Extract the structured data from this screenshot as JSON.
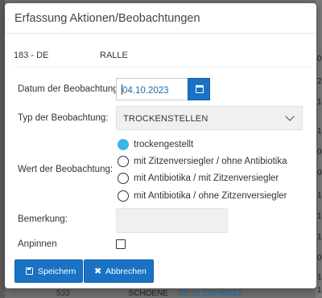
{
  "dialog": {
    "title": "Erfassung Aktionen/Beobachtungen"
  },
  "animal": {
    "id": "183 - DE",
    "name": "RALLE"
  },
  "form": {
    "date_label": "Datum der Beobachtung:",
    "date_value": "04.10.2023",
    "type_label": "Typ der Beobachtung:",
    "type_value": "TROCKENSTELLEN",
    "value_label": "Wert der Beobachtung:",
    "value_options": [
      {
        "label": "trockengestellt",
        "checked": true
      },
      {
        "label": "mit Zitzenversiegler / ohne Antibiotika",
        "checked": false
      },
      {
        "label": "mit Antibiotika / mit Zitzenversiegler",
        "checked": false
      },
      {
        "label": "mit Antibiotika / ohne Zitzenversiegler",
        "checked": false
      }
    ],
    "remark_label": "Bemerkung:",
    "remark_value": "",
    "pin_label": "Anpinnen",
    "pin_checked": false
  },
  "buttons": {
    "save": "Speichern",
    "cancel": "Abbrechen"
  },
  "icons": {
    "date_button": "calendar-icon",
    "select": "chevron-down-icon",
    "save": "floppy-disk-icon",
    "cancel": "close-icon"
  },
  "colors": {
    "primary": "#1a72c4",
    "radio_selected": "#3bb6e4",
    "date_text": "#1a6fb0"
  },
  "background": {
    "row_snippet": [
      "533",
      "SCHOENE",
      "DE 01 200 00533"
    ],
    "right_edge_chars": [
      "0",
      "2",
      "1",
      "1",
      "0",
      "0",
      "1",
      "1",
      "1",
      "0",
      "1",
      "1"
    ]
  }
}
